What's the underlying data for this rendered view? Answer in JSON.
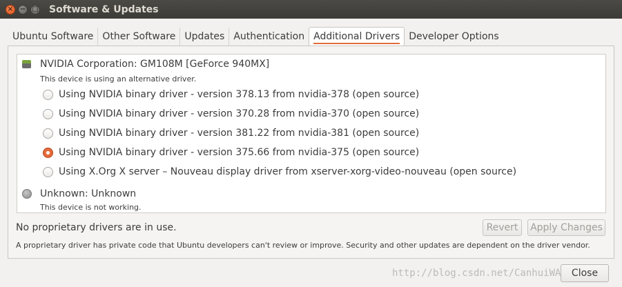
{
  "window": {
    "title": "Software & Updates",
    "controls": {
      "close": "×",
      "minimize": "−",
      "maximize": "□"
    }
  },
  "tabs": [
    {
      "label": "Ubuntu Software",
      "active": false
    },
    {
      "label": "Other Software",
      "active": false
    },
    {
      "label": "Updates",
      "active": false
    },
    {
      "label": "Authentication",
      "active": false
    },
    {
      "label": "Additional Drivers",
      "active": true
    },
    {
      "label": "Developer Options",
      "active": false
    }
  ],
  "devices": [
    {
      "name": "NVIDIA Corporation: GM108M [GeForce 940MX]",
      "status": "This device is using an alternative driver.",
      "icon": "gpu-icon",
      "options": [
        {
          "label": "Using NVIDIA binary driver - version 378.13 from nvidia-378 (open source)",
          "checked": false
        },
        {
          "label": "Using NVIDIA binary driver - version 370.28 from nvidia-370 (open source)",
          "checked": false
        },
        {
          "label": "Using NVIDIA binary driver - version 381.22 from nvidia-381 (open source)",
          "checked": false
        },
        {
          "label": "Using NVIDIA binary driver - version 375.66 from nvidia-375 (open source)",
          "checked": true
        },
        {
          "label": "Using X.Org X server – Nouveau display driver from xserver-xorg-video-nouveau (open source)",
          "checked": false
        }
      ]
    },
    {
      "name": "Unknown: Unknown",
      "status": "This device is not working.",
      "icon": "unknown-device-icon"
    }
  ],
  "status_text": "No proprietary drivers are in use.",
  "buttons": {
    "revert": "Revert",
    "apply": "Apply Changes",
    "close": "Close"
  },
  "footnote": "A proprietary driver has private code that Ubuntu developers can't review or improve. Security and other updates are dependent on the driver vendor.",
  "watermark": "http://blog.csdn.net/CanhuiWANG",
  "colors": {
    "accent": "#e46b3a",
    "titlebar": "#3c3b37"
  }
}
